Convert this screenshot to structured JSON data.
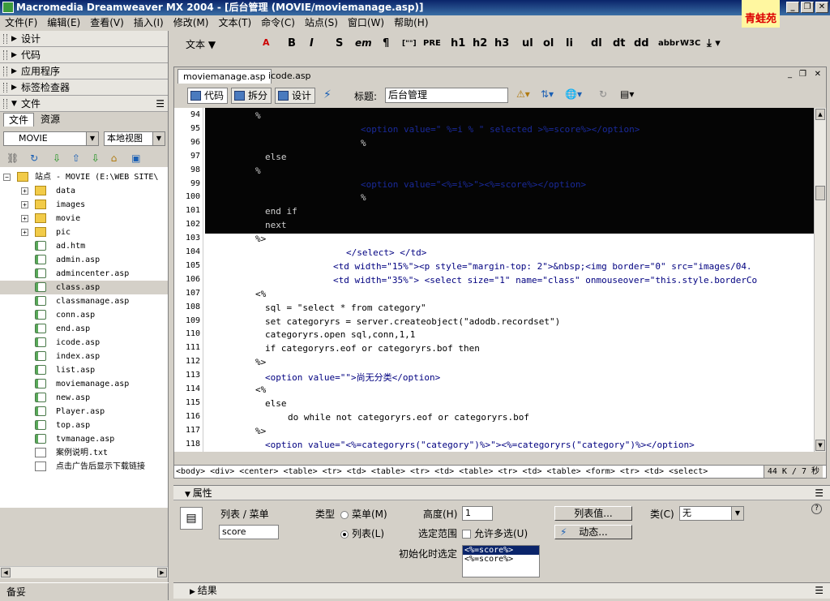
{
  "window": {
    "title": "Macromedia Dreamweaver MX 2004 - [后台管理 (MOVIE/moviemanage.asp)]",
    "logo_text": "青蛙苑"
  },
  "menu": [
    "文件(F)",
    "编辑(E)",
    "查看(V)",
    "插入(I)",
    "修改(M)",
    "文本(T)",
    "命令(C)",
    "站点(S)",
    "窗口(W)",
    "帮助(H)"
  ],
  "left_panels": [
    "设计",
    "代码",
    "应用程序",
    "标签检查器",
    "文件"
  ],
  "files_tabs": [
    "文件",
    "资源"
  ],
  "site_select": "MOVIE",
  "view_select": "本地视图",
  "tree": {
    "root": "站点 - MOVIE (E:\\WEB SITE\\",
    "folders": [
      "data",
      "images",
      "movie",
      "pic"
    ],
    "files": [
      "ad.htm",
      "admin.asp",
      "admincenter.asp",
      "class.asp",
      "classmanage.asp",
      "conn.asp",
      "end.asp",
      "icode.asp",
      "index.asp",
      "list.asp",
      "moviemanage.asp",
      "new.asp",
      "Player.asp",
      "top.asp",
      "tvmanage.asp",
      "案例说明.txt",
      "点击广告后显示下载链接"
    ],
    "selected": "class.asp"
  },
  "status_left": "备妥",
  "insert_toolbar": {
    "category": "文本",
    "buttons": [
      "B",
      "I",
      "S",
      "em",
      "¶",
      "[\"\"]",
      "PRE",
      "h1",
      "h2",
      "h3",
      "ul",
      "ol",
      "li",
      "dl",
      "dt",
      "dd",
      "abbr",
      "W3C"
    ]
  },
  "doc_tabs": [
    "moviemanage.asp",
    "icode.asp"
  ],
  "doc_toolbar": {
    "code": "代码",
    "split": "拆分",
    "design": "设计",
    "title_label": "标题:",
    "title_value": "后台管理"
  },
  "code_lines": [
    {
      "n": "94",
      "text": "%"
    },
    {
      "n": "95",
      "text": "<option value=\" %=i % \" selected >%=score%></option>"
    },
    {
      "n": "96",
      "text": "%"
    },
    {
      "n": "97",
      "text": "else"
    },
    {
      "n": "98",
      "text": "%"
    },
    {
      "n": "99",
      "text": "<option value=\"<%=i%>\"><%=score%></option>"
    },
    {
      "n": "100",
      "text": "%"
    },
    {
      "n": "101",
      "text": "end if"
    },
    {
      "n": "102",
      "text": "next"
    },
    {
      "n": "103",
      "text": "%>"
    },
    {
      "n": "104",
      "text": "</select> </td>"
    },
    {
      "n": "105",
      "text": "<td width=\"15%\"><p style=\"margin-top: 2\">&nbsp;<img border=\"0\" src=\"images/04."
    },
    {
      "n": "106",
      "text": "<td width=\"35%\"> <select size=\"1\" name=\"class\" onmouseover=\"this.style.borderCo"
    },
    {
      "n": "107",
      "text": "<%"
    },
    {
      "n": "108",
      "text": "sql = \"select * from category\""
    },
    {
      "n": "109",
      "text": "set categoryrs = server.createobject(\"adodb.recordset\")"
    },
    {
      "n": "110",
      "text": "categoryrs.open sql,conn,1,1"
    },
    {
      "n": "111",
      "text": "if categoryrs.eof or categoryrs.bof then"
    },
    {
      "n": "112",
      "text": "%>"
    },
    {
      "n": "113",
      "text": "<option value=\"\">尚无分类</option>"
    },
    {
      "n": "114",
      "text": "<%"
    },
    {
      "n": "115",
      "text": "else"
    },
    {
      "n": "116",
      "text": "do while not categoryrs.eof or categoryrs.bof"
    },
    {
      "n": "117",
      "text": "%>"
    },
    {
      "n": "118",
      "text": "<option value=\"<%=categoryrs(\"category\")%>\"><%=categoryrs(\"category\")%></option>"
    }
  ],
  "tag_path": "<body> <div> <center> <table> <tr> <td> <table> <tr> <td> <table> <tr> <td> <table> <form> <tr> <td> <select>",
  "file_size": "44 K / 7 秒",
  "properties": {
    "header": "属性",
    "kind_label": "列表 / 菜单",
    "name_value": "score",
    "type_label": "类型",
    "menu_radio": "菜单(M)",
    "list_radio": "列表(L)",
    "height_label": "高度(H)",
    "height_value": "1",
    "range_label": "选定范围",
    "multi_label": "允许多选(U)",
    "list_values_btn": "列表值...",
    "dynamic_btn": "动态...",
    "class_label": "类(C)",
    "class_value": "无",
    "init_label": "初始化时选定",
    "init_options": [
      "<%=score%>",
      "<%=score%>"
    ]
  },
  "results_header": "结果"
}
